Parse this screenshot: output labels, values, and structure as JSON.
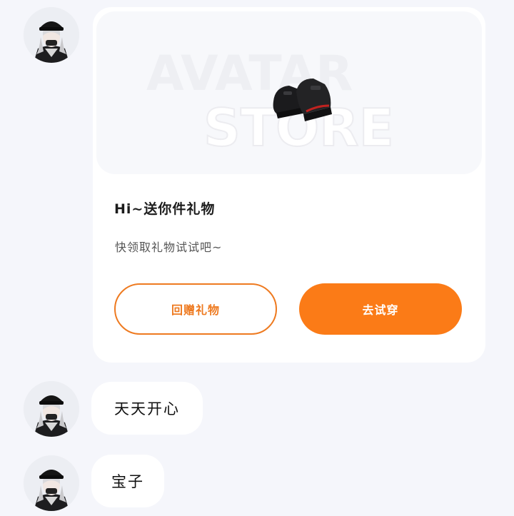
{
  "gift_card": {
    "banner_watermark": [
      "AVATAR",
      "STORE"
    ],
    "item_icon": "black-platform-shoes-icon",
    "title": "Hi~送你件礼物",
    "subtitle": "快领取礼物试试吧~",
    "return_gift_label": "回赠礼物",
    "try_on_label": "去试穿"
  },
  "messages": [
    {
      "text": "天天开心"
    },
    {
      "text": "宝子"
    }
  ],
  "avatar_icon": "user-avatar-girl-black-cap-icon",
  "colors": {
    "accent": "#fb7b17",
    "background": "#f5f6fb",
    "card": "#ffffff"
  }
}
